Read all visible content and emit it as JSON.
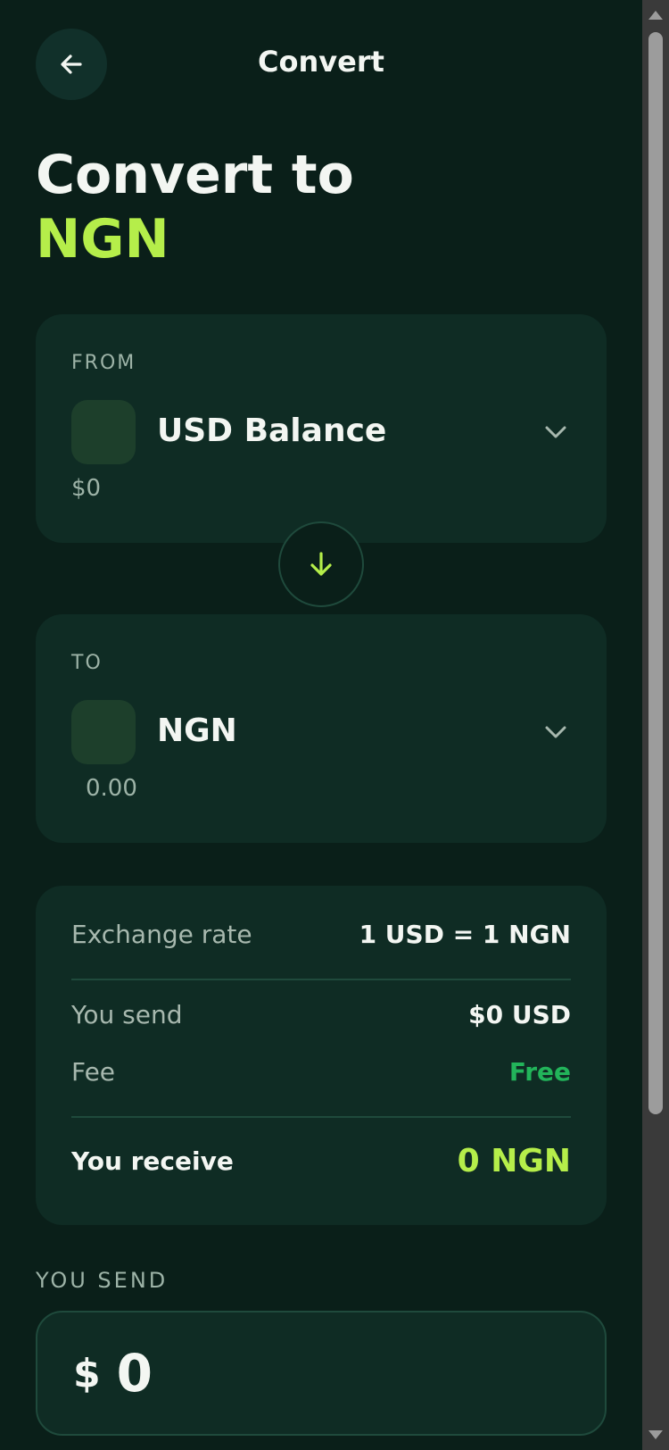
{
  "header": {
    "title": "Convert"
  },
  "hero": {
    "line1": "Convert to",
    "line2": "NGN"
  },
  "from": {
    "label": "FROM",
    "asset": "USD Balance",
    "amount": "$0"
  },
  "to": {
    "label": "TO",
    "asset": "NGN",
    "amount": "0.00"
  },
  "summary": {
    "rate_label": "Exchange rate",
    "rate_value": "1 USD = 1 NGN",
    "send_label": "You send",
    "send_value": "$0 USD",
    "fee_label": "Fee",
    "fee_value": "Free",
    "receive_label": "You receive",
    "receive_value": "0 NGN"
  },
  "amount_section": {
    "label": "YOU SEND",
    "currency": "$",
    "value": "0"
  },
  "colors": {
    "accent": "#b5ee4a",
    "fee_green": "#22b45a",
    "background": "#0a1f19",
    "card": "#0f2c24"
  },
  "icons": {
    "back": "arrow-left-icon",
    "chevron": "chevron-down-icon",
    "swap": "arrow-down-icon"
  }
}
